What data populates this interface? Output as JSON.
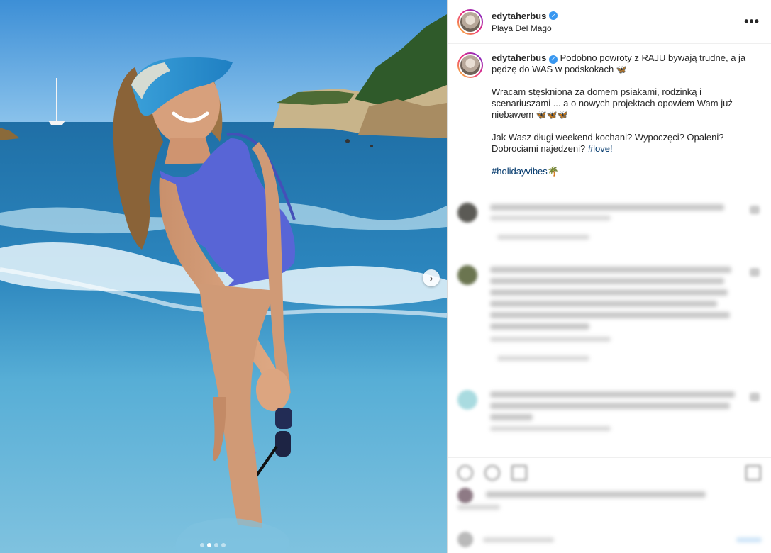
{
  "post": {
    "username": "edytaherbus",
    "location": "Playa Del Mago",
    "more_label": "•••"
  },
  "caption": {
    "username": "edytaherbus",
    "line1": "Podobno powroty z RAJU bywają trudne, a ja pędzę do WAS w podskokach",
    "emoji1": "🦋",
    "line2": "Wracam stęskniona za domem psiakami, rodzinką i scenariuszami ... a o nowych projektach opowiem Wam już niebawem",
    "emoji2": "🦋🦋🦋",
    "line3": "Jak Wasz długi weekend kochani? Wypoczęci? Opaleni? Dobrociami najedzeni?",
    "hashtag_love": "#love!",
    "hashtag_holiday": "#holidayvibes",
    "palm": "🌴"
  },
  "carousel": {
    "next_icon": "›",
    "dots": 4,
    "active_dot": 1
  }
}
